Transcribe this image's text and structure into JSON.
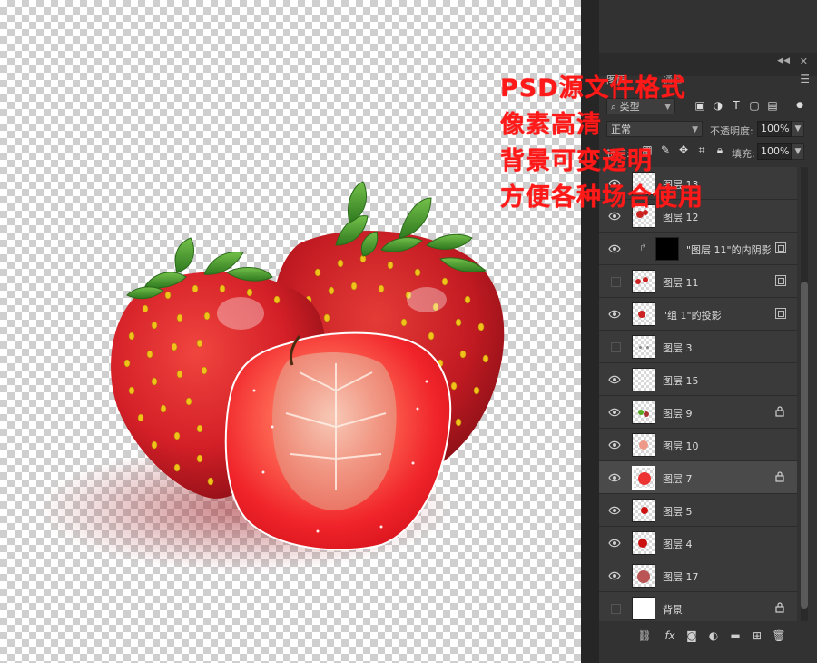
{
  "promo": {
    "lines": [
      "PSD源文件格式",
      "像素高清",
      "背景可变透明",
      "方便各种场合使用"
    ],
    "color": "#ff1a1a"
  },
  "panel": {
    "tab_label": "图层",
    "tab_other_label": "通道",
    "filter_kind": "类型",
    "blend_mode": "正常",
    "opacity_label": "不透明度:",
    "opacity_value": "100%",
    "fill_label": "填充:",
    "fill_value": "100%"
  },
  "layers": [
    {
      "name": "图层 13",
      "visible": true,
      "locked": false,
      "fx": false
    },
    {
      "name": "图层 12",
      "visible": true,
      "locked": false,
      "fx": false
    },
    {
      "name": "\"图层 11\"的内阴影",
      "visible": true,
      "locked": false,
      "fx": true,
      "clipped": true
    },
    {
      "name": "图层 11",
      "visible": false,
      "locked": false,
      "fx": true
    },
    {
      "name": "\"组 1\"的投影",
      "visible": true,
      "locked": false,
      "fx": true
    },
    {
      "name": "图层 3",
      "visible": false,
      "locked": false,
      "fx": false
    },
    {
      "name": "图层 15",
      "visible": true,
      "locked": false,
      "fx": false
    },
    {
      "name": "图层 9",
      "visible": true,
      "locked": true,
      "fx": false
    },
    {
      "name": "图层 10",
      "visible": true,
      "locked": false,
      "fx": false
    },
    {
      "name": "图层 7",
      "visible": true,
      "locked": true,
      "fx": false,
      "selected": true
    },
    {
      "name": "图层 5",
      "visible": true,
      "locked": false,
      "fx": false
    },
    {
      "name": "图层 4",
      "visible": true,
      "locked": false,
      "fx": false
    },
    {
      "name": "图层 17",
      "visible": true,
      "locked": false,
      "fx": false
    },
    {
      "name": "背景",
      "visible": false,
      "locked": true,
      "fx": false,
      "background": true
    }
  ],
  "colors": {
    "strawberry_red": "#d8202a",
    "seed_yellow": "#f2c21a",
    "leaf_green": "#4d9a2e",
    "panel_bg": "#323232"
  }
}
